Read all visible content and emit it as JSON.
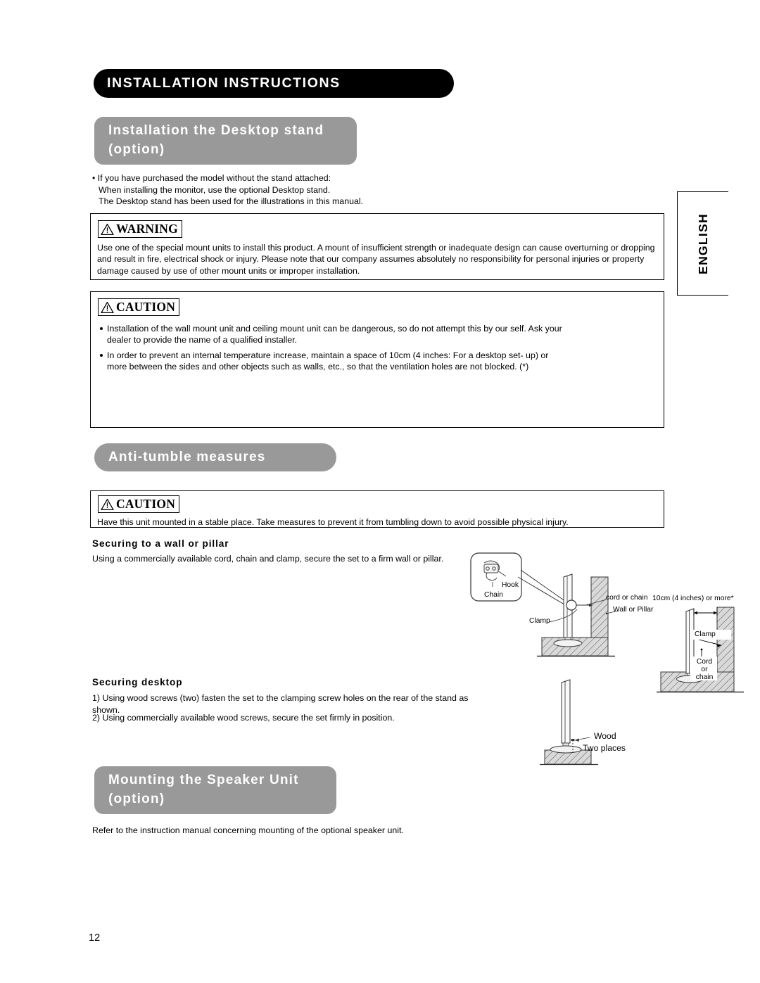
{
  "page": {
    "number": "12",
    "language_tab": "ENGLISH",
    "title": "INSTALLATION INSTRUCTIONS"
  },
  "sections": {
    "desktop_stand": {
      "heading": "Installation the Desktop stand (option)",
      "heading_line1": "Installation the Desktop stand",
      "heading_line2": "(option)",
      "intro": {
        "line1": "• If you have purchased the model without the stand attached:",
        "line2": "When installing the monitor, use the optional Desktop stand.",
        "line3": "The Desktop stand has been used for the illustrations in this manual."
      },
      "warning": {
        "badge": "WARNING",
        "body": "Use one of the special mount units to install this product. A mount of insufficient strength or inadequate design can cause overturning or dropping and result in fire, electrical shock or injury. Please note that our company assumes absolutely no responsibility for personal injuries or property damage caused by use of other mount units or improper installation."
      },
      "caution": {
        "badge": "CAUTION",
        "bullets": [
          "Installation of the wall mount unit and ceiling mount unit can be dangerous, so do not attempt this by our self. Ask your dealer to provide the name of a qualified installer.",
          "In order to prevent an internal temperature increase, maintain a space of 10cm (4 inches: For a desktop set- up) or more between the sides and other objects such as walls, etc., so that the ventilation holes are not blocked. (*)"
        ]
      },
      "figure_clearance": {
        "name": "desktop-clearance-diagram",
        "dimension_label": "10cm (4 inches) or more*",
        "clamp_label": "Clamp",
        "cord_label_line1": "Cord",
        "cord_label_line2": "or",
        "cord_label_line3": "chain"
      }
    },
    "anti_tumble": {
      "heading": "Anti-tumble measures",
      "caution": {
        "badge": "CAUTION",
        "body": "Have this unit mounted in a stable place. Take measures to prevent it from tumbling down to avoid possible physical injury."
      },
      "securing_wall": {
        "sub_heading": "Securing to a wall or pillar",
        "body": "Using a commercially available cord, chain and clamp, secure the set to a firm wall or pillar.",
        "figure": {
          "name": "securing-wall-diagram",
          "hook_label": "Hook",
          "chain_label": "Chain",
          "cord_label": "cord or chain",
          "wall_label": "Wall or Pillar",
          "clamp_label": "Clamp"
        }
      },
      "securing_desktop": {
        "sub_heading": "Securing desktop",
        "step1": "1) Using wood screws (two) fasten the set to the clamping screw holes on the rear of the stand as shown.",
        "step2": "2) Using commercially available wood screws, secure the set firmly in position.",
        "figure": {
          "name": "securing-desktop-diagram",
          "wood_label": "Wood",
          "two_places_label": "Two places"
        }
      }
    },
    "speaker_unit": {
      "heading": "Mounting the Speaker Unit (option)",
      "heading_line1": "Mounting the Speaker Unit",
      "heading_line2": "(option)",
      "body": "Refer to the instruction manual concerning mounting of the optional speaker unit."
    }
  },
  "colors": {
    "title_bar": "#000000",
    "section_heading_bar": "#999999",
    "heading_text": "#ffffff",
    "body_text": "#000000",
    "hatch_fill": "#b8b8b8"
  }
}
